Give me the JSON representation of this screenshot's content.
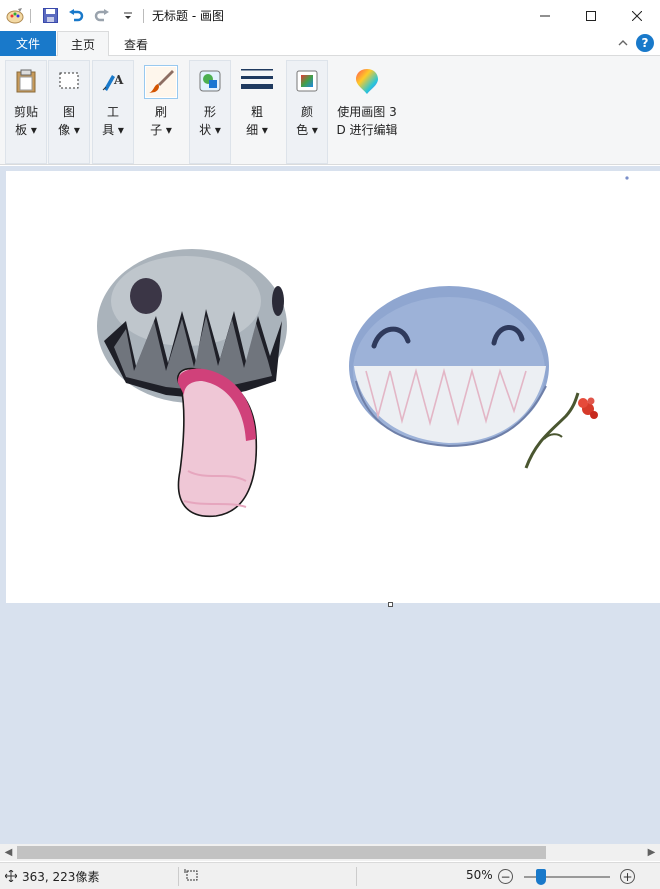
{
  "window": {
    "title": "无标题 - 画图"
  },
  "tabs": {
    "file": "文件",
    "home": "主页",
    "view": "查看"
  },
  "ribbon": {
    "clipboard": "剪贴\n板 ▾",
    "image": "图\n像 ▾",
    "tools": "工\n具 ▾",
    "brushes": "刷\n子 ▾",
    "shapes": "形\n状 ▾",
    "size": "粗\n细 ▾",
    "colors": "颜\n色 ▾",
    "paint3d": "使用画图 3\nD 进行编辑"
  },
  "status": {
    "cursor_position": "363, 223像素",
    "zoom_level": "50%",
    "zoom_fraction": 0.2
  },
  "colors": {
    "accent": "#1979ca",
    "canvas_bg": "#d8e1ee"
  },
  "icons": [
    "paint-app-icon",
    "save-icon",
    "undo-icon",
    "redo-icon",
    "customize-qa-icon",
    "minimize-icon",
    "maximize-icon",
    "close-icon",
    "collapse-ribbon-icon",
    "help-icon",
    "clipboard-icon",
    "select-icon",
    "tools-icon",
    "brush-icon",
    "shapes-icon",
    "size-icon",
    "colors-icon",
    "paint3d-icon",
    "cursor-position-icon",
    "selection-size-icon",
    "zoom-out-icon",
    "zoom-in-icon"
  ]
}
